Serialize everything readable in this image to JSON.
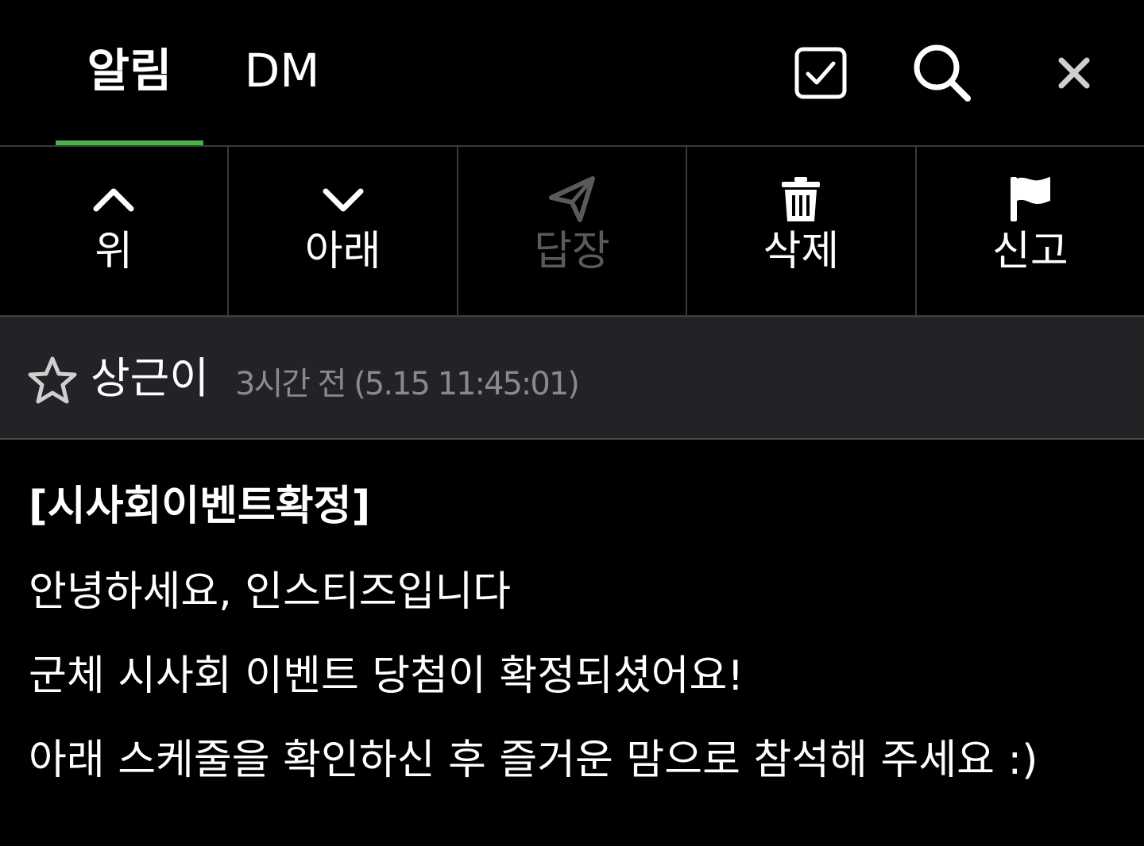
{
  "header": {
    "tabs": [
      {
        "label": "알림",
        "active": true
      },
      {
        "label": "DM",
        "active": false
      }
    ],
    "icons": [
      "checkbox-icon",
      "search-icon",
      "close-icon"
    ],
    "accent_color": "#4caf50"
  },
  "toolbar": {
    "items": [
      {
        "label": "위",
        "icon": "chevron-up-icon",
        "enabled": true
      },
      {
        "label": "아래",
        "icon": "chevron-down-icon",
        "enabled": true
      },
      {
        "label": "답장",
        "icon": "send-icon",
        "enabled": false
      },
      {
        "label": "삭제",
        "icon": "trash-icon",
        "enabled": true
      },
      {
        "label": "신고",
        "icon": "flag-icon",
        "enabled": true
      }
    ]
  },
  "message": {
    "sender": "상근이",
    "time": "3시간 전 (5.15 11:45:01)",
    "starred": false,
    "title": "[시사회이벤트확정]",
    "lines": [
      "안녕하세요, 인스티즈입니다",
      "군체 시사회 이벤트 당첨이 확정되셨어요!",
      "아래 스케줄을 확인하신 후 즐거운 맘으로 참석해 주세요 :)"
    ]
  }
}
